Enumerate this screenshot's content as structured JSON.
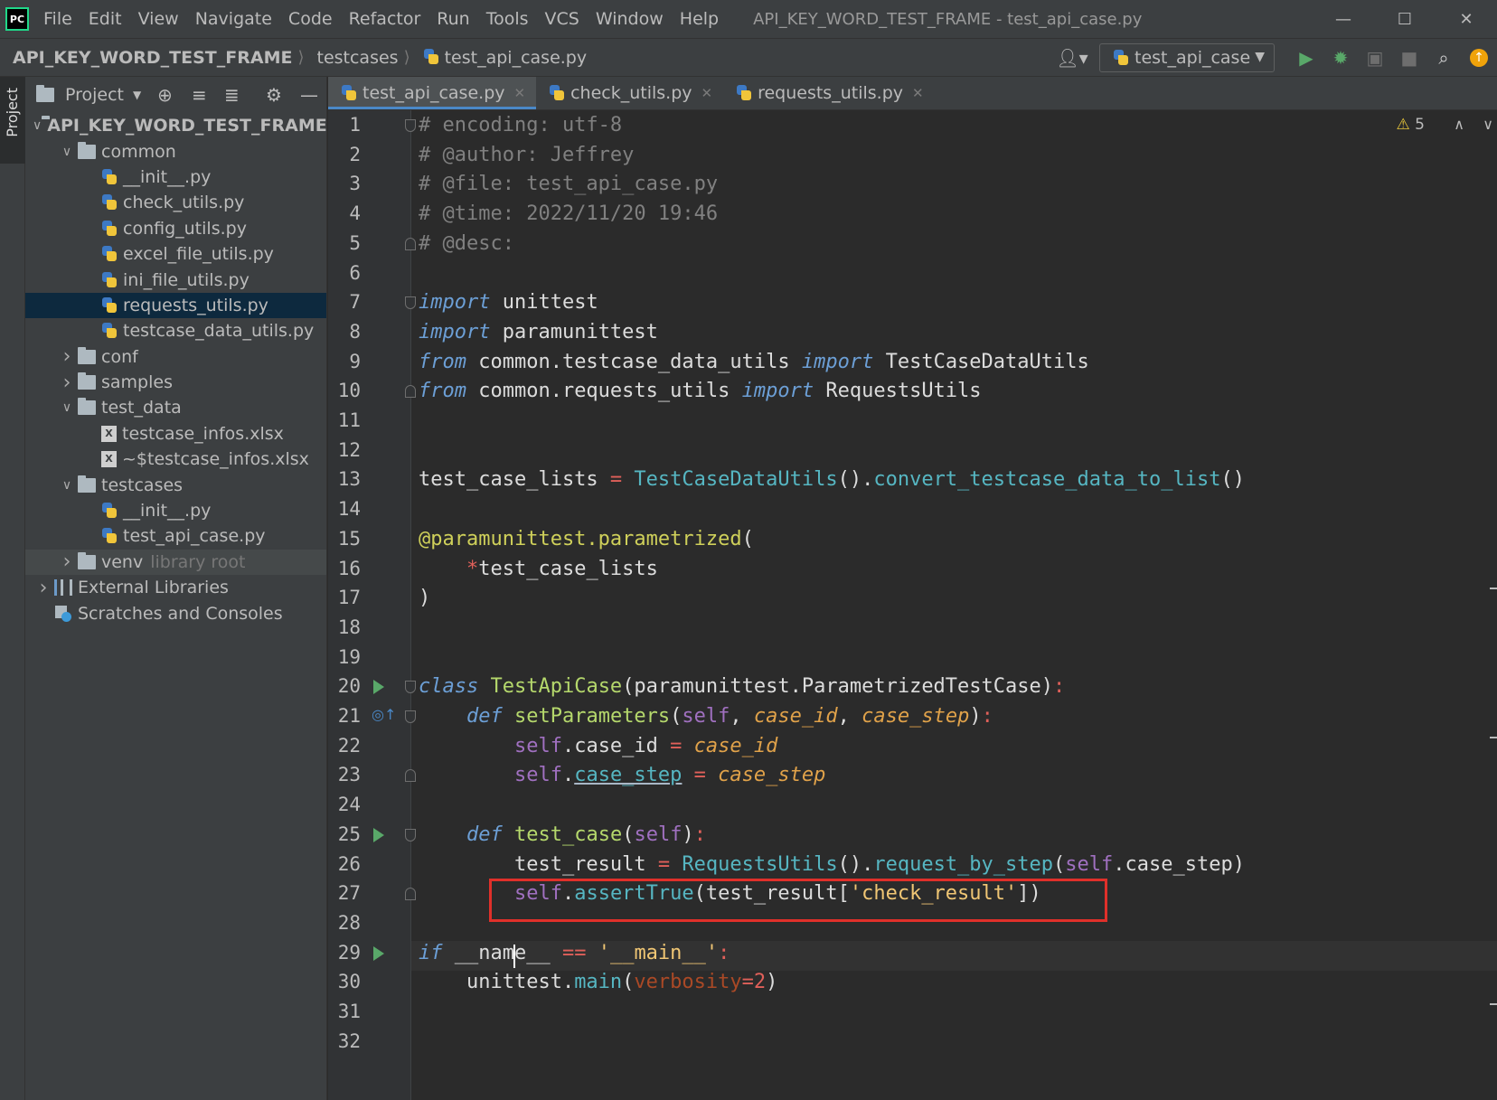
{
  "menubar": {
    "logo": "PC",
    "items": [
      "File",
      "Edit",
      "View",
      "Navigate",
      "Code",
      "Refactor",
      "Run",
      "Tools",
      "VCS",
      "Window",
      "Help"
    ],
    "title": "API_KEY_WORD_TEST_FRAME - test_api_case.py"
  },
  "navbar": {
    "crumbs": [
      "API_KEY_WORD_TEST_FRAME",
      "testcases",
      "test_api_case.py"
    ],
    "run_config": "test_api_case"
  },
  "left_stripe": {
    "label": "Project"
  },
  "project_panel": {
    "title": "Project",
    "tree": [
      {
        "label": "API_KEY_WORD_TEST_FRAME",
        "suffix": "E",
        "depth": 0,
        "arrow": "down",
        "icon": "folder-icon",
        "bold": true
      },
      {
        "label": "common",
        "depth": 1,
        "arrow": "down",
        "icon": "folder-icon"
      },
      {
        "label": "__init__.py",
        "depth": 2,
        "icon": "python-file-icon"
      },
      {
        "label": "check_utils.py",
        "depth": 2,
        "icon": "python-file-icon"
      },
      {
        "label": "config_utils.py",
        "depth": 2,
        "icon": "python-file-icon"
      },
      {
        "label": "excel_file_utils.py",
        "depth": 2,
        "icon": "python-file-icon"
      },
      {
        "label": "ini_file_utils.py",
        "depth": 2,
        "icon": "python-file-icon"
      },
      {
        "label": "requests_utils.py",
        "depth": 2,
        "icon": "python-file-icon",
        "selected": true
      },
      {
        "label": "testcase_data_utils.py",
        "depth": 2,
        "icon": "python-file-icon"
      },
      {
        "label": "conf",
        "depth": 1,
        "arrow": "right",
        "icon": "folder-icon"
      },
      {
        "label": "samples",
        "depth": 1,
        "arrow": "right",
        "icon": "folder-icon"
      },
      {
        "label": "test_data",
        "depth": 1,
        "arrow": "down",
        "icon": "folder-icon"
      },
      {
        "label": "testcase_infos.xlsx",
        "depth": 2,
        "icon": "excel-file-icon"
      },
      {
        "label": "~$testcase_infos.xlsx",
        "depth": 2,
        "icon": "excel-file-icon"
      },
      {
        "label": "testcases",
        "depth": 1,
        "arrow": "down",
        "icon": "folder-icon"
      },
      {
        "label": "__init__.py",
        "depth": 2,
        "icon": "python-file-icon"
      },
      {
        "label": "test_api_case.py",
        "depth": 2,
        "icon": "python-file-icon"
      },
      {
        "label": "venv",
        "suffix": "library root",
        "depth": 1,
        "arrow": "right",
        "icon": "folder-icon",
        "highlight": true
      },
      {
        "label": "External Libraries",
        "depth": 0,
        "arrow": "right",
        "icon": "library-icon"
      },
      {
        "label": "Scratches and Consoles",
        "depth": 0,
        "icon": "scratches-icon"
      }
    ]
  },
  "tabs": [
    {
      "label": "test_api_case.py",
      "active": true
    },
    {
      "label": "check_utils.py",
      "active": false
    },
    {
      "label": "requests_utils.py",
      "active": false
    }
  ],
  "editor": {
    "warnings": "5",
    "line_numbers": [
      "1",
      "2",
      "3",
      "4",
      "5",
      "6",
      "7",
      "8",
      "9",
      "10",
      "11",
      "12",
      "13",
      "14",
      "15",
      "16",
      "17",
      "18",
      "19",
      "20",
      "21",
      "22",
      "23",
      "24",
      "25",
      "26",
      "27",
      "28",
      "29",
      "30",
      "31",
      "32"
    ]
  },
  "icons": {
    "run": "run-icon",
    "debug": "debug-icon",
    "coverage": "coverage-icon",
    "stop": "stop-icon",
    "search": "search-icon",
    "update": "update-icon",
    "user": "user-icon"
  },
  "colors": {
    "accent": "#4a88c7",
    "selected_row": "#0d293e",
    "highlight_box": "#e0302a",
    "run_green": "#59a869"
  }
}
